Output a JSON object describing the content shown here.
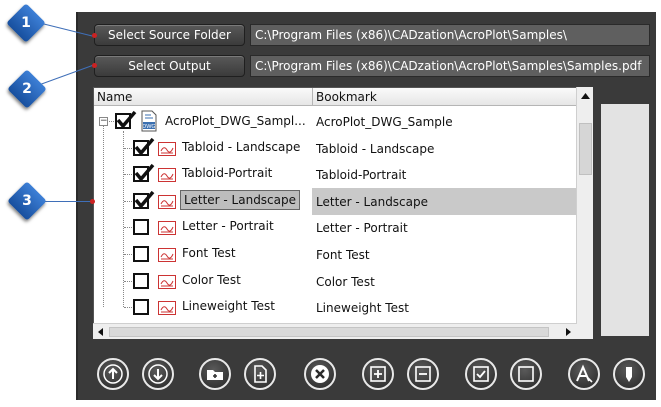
{
  "buttons": {
    "select_source": "Select Source Folder",
    "select_output": "Select Output"
  },
  "fields": {
    "source_path": "C:\\Program Files (x86)\\CADzation\\AcroPlot\\Samples\\",
    "output_path": "C:\\Program Files (x86)\\CADzation\\AcroPlot\\Samples\\Samples.pdf"
  },
  "tree": {
    "columns": {
      "name": "Name",
      "bookmark": "Bookmark"
    },
    "root": {
      "name": "AcroPlot_DWG_Sampl...",
      "bookmark": "AcroPlot_DWG_Sample",
      "checked": true,
      "icon": "dwg-file-icon"
    },
    "items": [
      {
        "name": "Tabloid - Landscape",
        "bookmark": "Tabloid - Landscape",
        "checked": true,
        "selected": false
      },
      {
        "name": "Tabloid-Portrait",
        "bookmark": "Tabloid-Portrait",
        "checked": true,
        "selected": false
      },
      {
        "name": "Letter - Landscape",
        "bookmark": "Letter - Landscape",
        "checked": true,
        "selected": true
      },
      {
        "name": "Letter - Portrait",
        "bookmark": "Letter - Portrait",
        "checked": false,
        "selected": false
      },
      {
        "name": "Font Test",
        "bookmark": "Font Test",
        "checked": false,
        "selected": false
      },
      {
        "name": "Color Test",
        "bookmark": "Color Test",
        "checked": false,
        "selected": false
      },
      {
        "name": "Lineweight Test",
        "bookmark": "Lineweight Test",
        "checked": false,
        "selected": false
      }
    ]
  },
  "toolbar": {
    "icons": [
      "arrow-up-icon",
      "arrow-down-icon",
      "add-folder-icon",
      "add-file-icon",
      "remove-icon",
      "expand-all-icon",
      "collapse-all-icon",
      "check-all-icon",
      "uncheck-all-icon",
      "font-settings-icon",
      "pen-settings-icon"
    ]
  },
  "callouts": [
    "1",
    "2",
    "3"
  ],
  "colors": {
    "panel": "#3a3a3a",
    "callout": "#2a64b8",
    "selection": "#bdbdbd"
  }
}
